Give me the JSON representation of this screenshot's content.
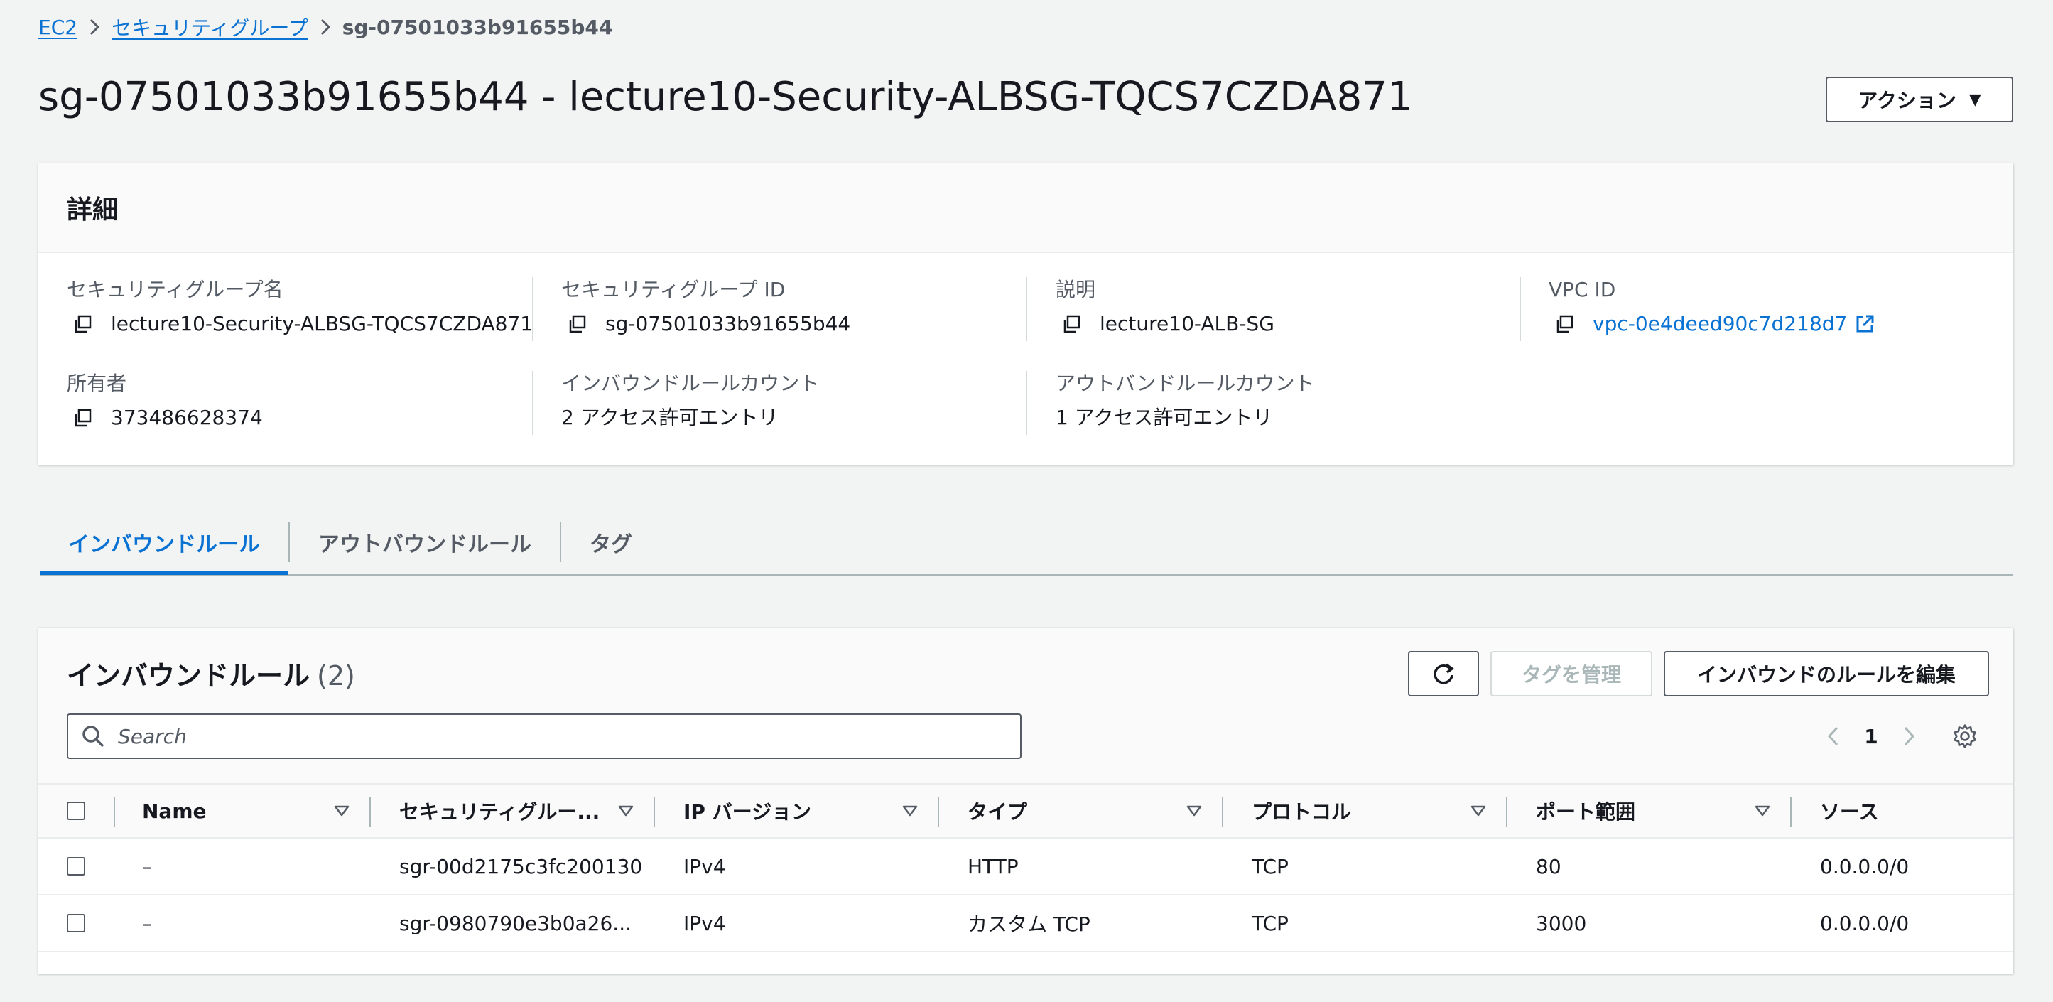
{
  "breadcrumb": {
    "items": [
      "EC2",
      "セキュリティグループ"
    ],
    "current": "sg-07501033b91655b44"
  },
  "page": {
    "title": "sg-07501033b91655b44 - lecture10-Security-ALBSG-TQCS7CZDA871",
    "actions_label": "アクション"
  },
  "details": {
    "header": "詳細",
    "sg_name_label": "セキュリティグループ名",
    "sg_name_value": "lecture10-Security-ALBSG-TQCS7CZDA871",
    "sg_id_label": "セキュリティグループ ID",
    "sg_id_value": "sg-07501033b91655b44",
    "description_label": "説明",
    "description_value": "lecture10-ALB-SG",
    "vpc_label": "VPC ID",
    "vpc_value": "vpc-0e4deed90c7d218d7",
    "owner_label": "所有者",
    "owner_value": "373486628374",
    "inbound_count_label": "インバウンドルールカウント",
    "inbound_count_value": "2 アクセス許可エントリ",
    "outbound_count_label": "アウトバンドルールカウント",
    "outbound_count_value": "1 アクセス許可エントリ"
  },
  "tabs": [
    {
      "label": "インバウンドルール",
      "active": true
    },
    {
      "label": "アウトバウンドルール",
      "active": false
    },
    {
      "label": "タグ",
      "active": false
    }
  ],
  "rules": {
    "title": "インバウンドルール",
    "count": "(2)",
    "manage_tags_label": "タグを管理",
    "edit_label": "インバウンドのルールを編集",
    "search_placeholder": "Search",
    "page": "1",
    "columns": [
      "Name",
      "セキュリティグルー...",
      "IP バージョン",
      "タイプ",
      "プロトコル",
      "ポート範囲",
      "ソース"
    ],
    "rows": [
      {
        "name": "–",
        "rule_id": "sgr-00d2175c3fc200130",
        "ip_version": "IPv4",
        "type": "HTTP",
        "protocol": "TCP",
        "port": "80",
        "source": "0.0.0.0/0"
      },
      {
        "name": "–",
        "rule_id": "sgr-0980790e3b0a26...",
        "ip_version": "IPv4",
        "type": "カスタム TCP",
        "protocol": "TCP",
        "port": "3000",
        "source": "0.0.0.0/0"
      }
    ]
  },
  "colors": {
    "link": "#0972d3",
    "background": "#f2f3f3",
    "text": "#16191f",
    "secondary_text": "#545b64"
  }
}
